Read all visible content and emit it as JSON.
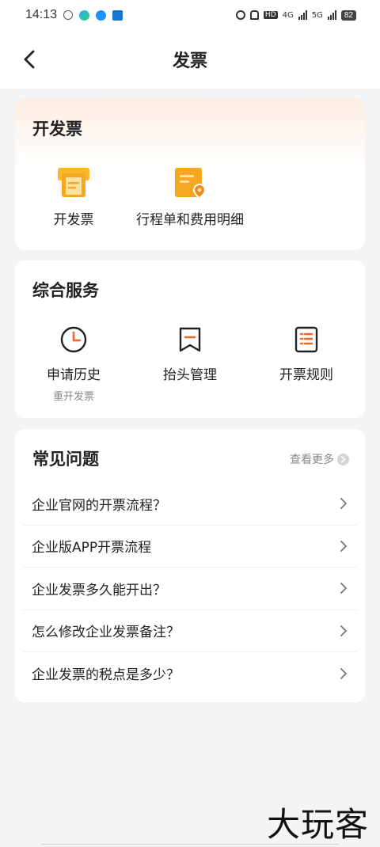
{
  "status_bar": {
    "time": "14:13",
    "network_1": "HD",
    "network_2": "4G",
    "network_3": "5G",
    "battery": "82"
  },
  "nav": {
    "title": "发票"
  },
  "invoice_card": {
    "title": "开发票",
    "tiles": [
      {
        "label": "开发票",
        "icon": "invoice-icon"
      },
      {
        "label": "行程单和费用明细",
        "icon": "itinerary-icon"
      }
    ],
    "accent_color": "#f5a623"
  },
  "services_card": {
    "title": "综合服务",
    "tiles": [
      {
        "label": "申请历史",
        "sub": "重开发票",
        "icon": "clock-icon"
      },
      {
        "label": "抬头管理",
        "icon": "bookmark-icon"
      },
      {
        "label": "开票规则",
        "icon": "rules-icon"
      }
    ],
    "accent_color": "#f0672b"
  },
  "faq_card": {
    "title": "常见问题",
    "more_label": "查看更多",
    "items": [
      "企业官网的开票流程？",
      "企业版APP开票流程",
      "企业发票多久能开出？",
      "怎么修改企业发票备注？",
      "企业发票的税点是多少？"
    ]
  },
  "watermark": "大玩客"
}
